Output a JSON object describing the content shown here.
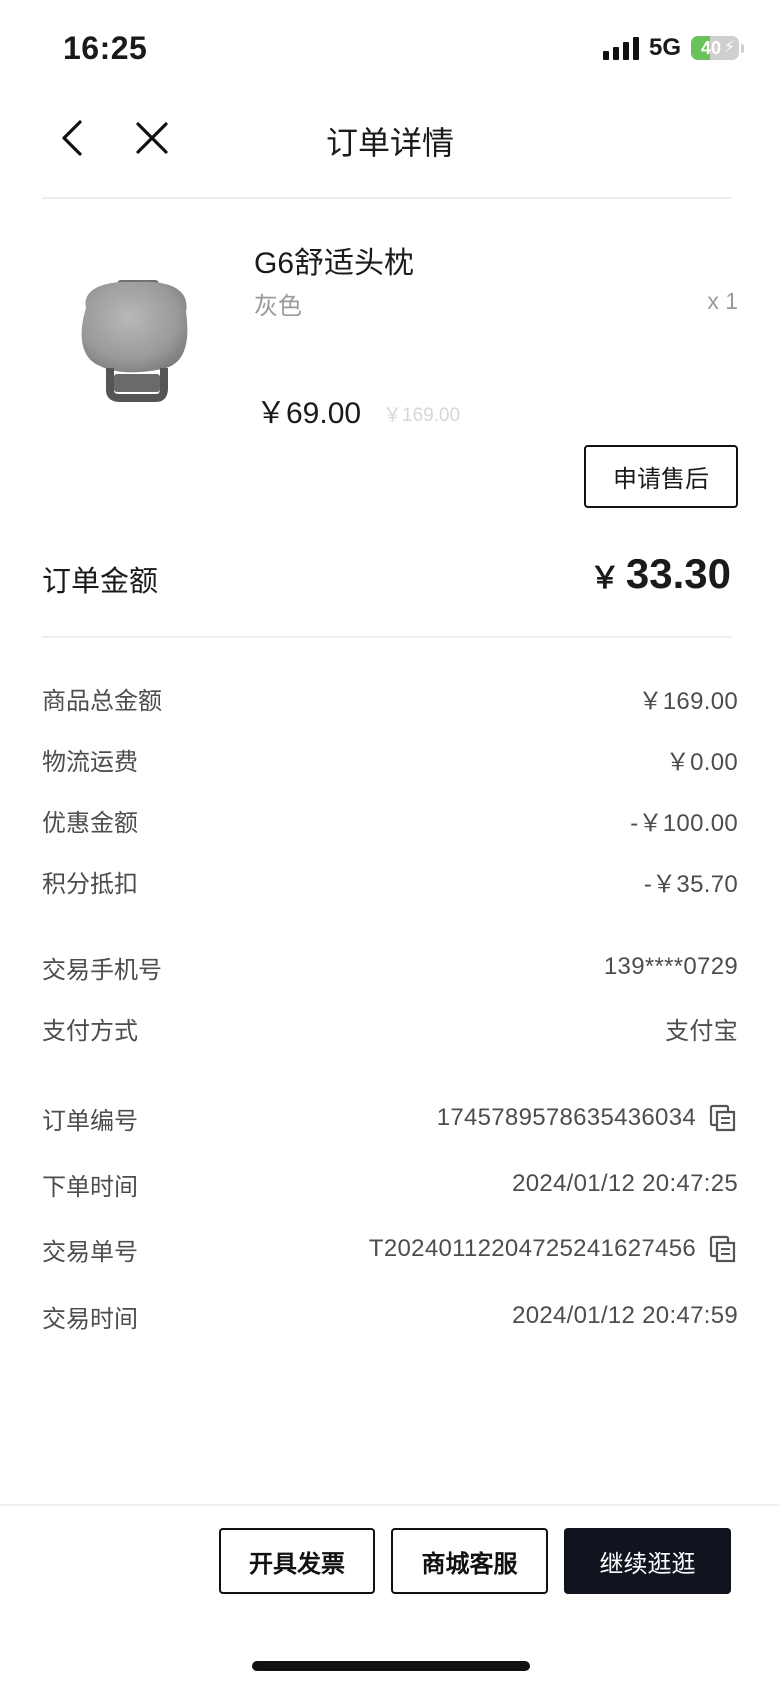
{
  "status": {
    "time": "16:25",
    "network": "5G",
    "battery": "40",
    "battery_fraction": 0.4
  },
  "nav": {
    "title": "订单详情"
  },
  "product": {
    "name": "G6舒适头枕",
    "variant": "灰色",
    "quantity": "x 1",
    "price": "￥69.00",
    "original_price": "￥169.00",
    "after_sale_label": "申请售后"
  },
  "order_amount": {
    "label": "订单金额",
    "symbol": "￥",
    "value": "33.30"
  },
  "summary": [
    {
      "label": "商品总金额",
      "value": "￥169.00"
    },
    {
      "label": "物流运费",
      "value": "￥0.00"
    },
    {
      "label": "优惠金额",
      "value": "-￥100.00"
    },
    {
      "label": "积分抵扣",
      "value": "-￥35.70"
    }
  ],
  "payment": [
    {
      "label": "交易手机号",
      "value": "139****0729"
    },
    {
      "label": "支付方式",
      "value": "支付宝"
    }
  ],
  "order_info": [
    {
      "label": "订单编号",
      "value": "1745789578635436034"
    },
    {
      "label": "下单时间",
      "value": "2024/01/12 20:47:25"
    },
    {
      "label": "交易单号",
      "value": "T20240112204725241627456"
    },
    {
      "label": "交易时间",
      "value": "2024/01/12 20:47:59"
    }
  ],
  "actions": {
    "invoice": "开具发票",
    "service": "商城客服",
    "continue": "继续逛逛"
  },
  "colors": {
    "primary_dark": "#10141f",
    "muted": "#9a9a9a",
    "battery_green": "#6ac35a"
  }
}
